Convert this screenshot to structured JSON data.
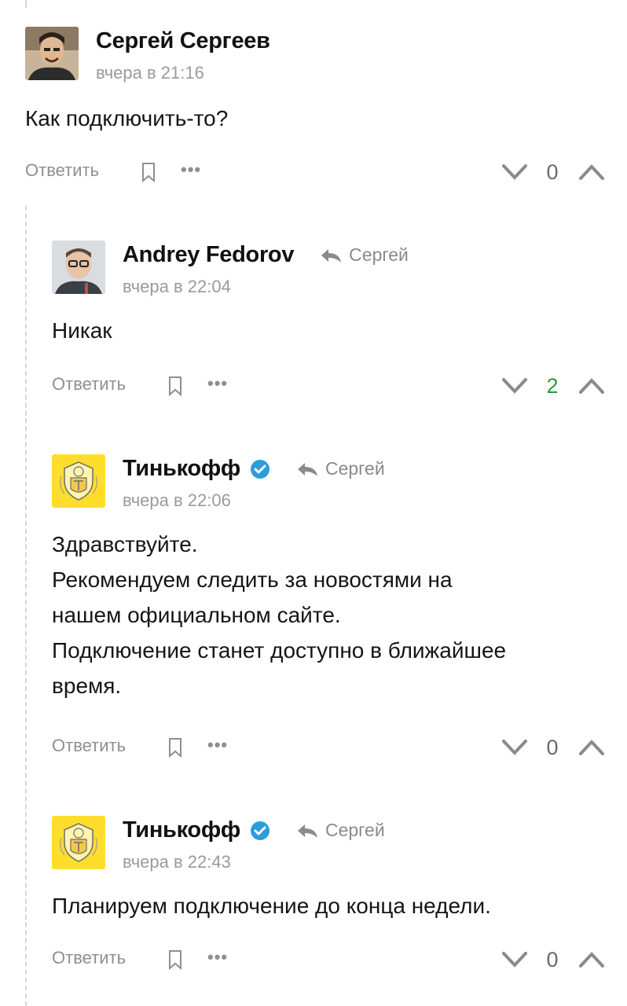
{
  "comments": [
    {
      "author": "Сергей Сергеев",
      "time": "вчера в 21:16",
      "text_lines": [
        "Как подключить-то?"
      ],
      "reply_label": "Ответить",
      "score": "0",
      "verified": false,
      "reply_to": ""
    },
    {
      "author": "Andrey Fedorov",
      "time": "вчера в 22:04",
      "text_lines": [
        "Никак"
      ],
      "reply_label": "Ответить",
      "score": "2",
      "verified": false,
      "reply_to": "Сергей"
    },
    {
      "author": "Тинькофф",
      "time": "вчера в 22:06",
      "text_lines": [
        "Здравствуйте.",
        "Рекомендуем следить за новостями на",
        "нашем официальном сайте.",
        "Подключение станет доступно в ближайшее",
        "время."
      ],
      "reply_label": "Ответить",
      "score": "0",
      "verified": true,
      "reply_to": "Сергей"
    },
    {
      "author": "Тинькофф",
      "time": "вчера в 22:43",
      "text_lines": [
        "Планируем подключение до конца недели."
      ],
      "reply_label": "Ответить",
      "score": "0",
      "verified": true,
      "reply_to": "Сергей"
    }
  ],
  "colors": {
    "score_positive": "#2b9a3a",
    "score_neutral": "#6a6a6a",
    "verified_badge": "#2d9cdb",
    "brand_yellow": "#ffdd2d"
  },
  "icons": [
    "bookmark-icon",
    "more-icon",
    "vote-down-icon",
    "vote-up-icon",
    "reply-arrow-icon",
    "verified-icon"
  ]
}
